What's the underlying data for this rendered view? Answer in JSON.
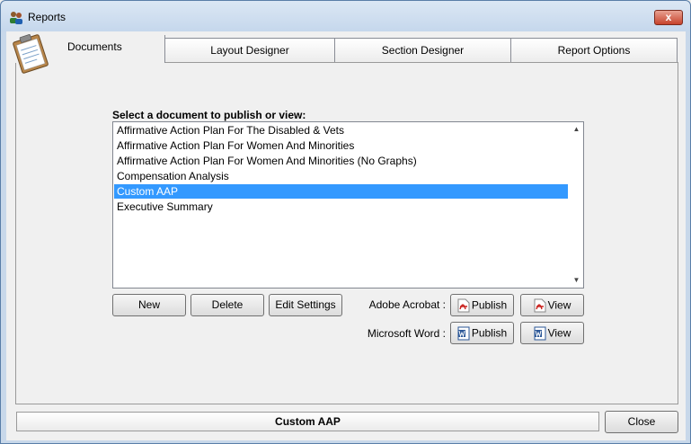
{
  "window": {
    "title": "Reports",
    "close_glyph": "x"
  },
  "tabs": [
    {
      "label": "Documents",
      "active": true
    },
    {
      "label": "Layout Designer",
      "active": false
    },
    {
      "label": "Section Designer",
      "active": false
    },
    {
      "label": "Report Options",
      "active": false
    }
  ],
  "documents": {
    "label": "Select a document to publish or view:",
    "items": [
      "Affirmative Action Plan For The Disabled & Vets",
      "Affirmative Action Plan For Women And Minorities",
      "Affirmative Action Plan For Women And Minorities (No Graphs)",
      "Compensation Analysis",
      "Custom AAP",
      "Executive Summary"
    ],
    "selected_index": 4,
    "scroll_up": "▲",
    "scroll_down": "▼"
  },
  "actions": {
    "new": "New",
    "delete": "Delete",
    "edit_settings": "Edit Settings"
  },
  "publish": {
    "acrobat_label": "Adobe Acrobat :",
    "word_label": "Microsoft Word :",
    "publish": "Publish",
    "view": "View"
  },
  "status": {
    "selected_document": "Custom AAP"
  },
  "footer": {
    "close": "Close"
  },
  "icons": {
    "title": "users-icon",
    "tab_decoration": "clipboard-icon",
    "acrobat": "pdf-icon",
    "word": "word-icon"
  },
  "colors": {
    "selection": "#3399ff",
    "pdf_red": "#c8201c",
    "word_blue": "#2b5797"
  }
}
